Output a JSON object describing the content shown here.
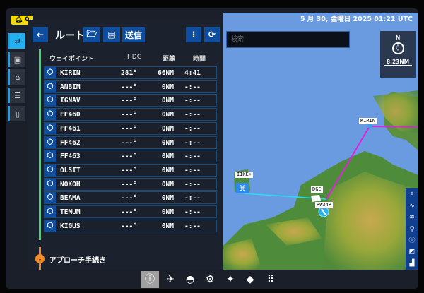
{
  "alerts": {
    "count": "0",
    "icon": "bell-icon"
  },
  "sidebar": {
    "items": [
      {
        "name": "route",
        "icon": "route-icon"
      },
      {
        "name": "checklist",
        "icon": "clipboard-icon"
      },
      {
        "name": "weight",
        "icon": "weight-icon"
      },
      {
        "name": "notes",
        "icon": "document-icon"
      },
      {
        "name": "clipboard",
        "icon": "clipboard-blank-icon"
      }
    ]
  },
  "toolbar": {
    "back": "←",
    "title": "ルート",
    "open": "🗁",
    "save": "💾",
    "send": "送信",
    "collapse": "⌄",
    "refresh": "⟳"
  },
  "table": {
    "headers": {
      "waypoint": "ウェイポイント",
      "hdg": "HDG",
      "dist": "距離",
      "time": "時間"
    },
    "rows": [
      {
        "name": "KIRIN",
        "hdg": "281°",
        "dist": "66NM",
        "time": "4:41"
      },
      {
        "name": "ANBIM",
        "hdg": "---°",
        "dist": "0NM",
        "time": "-:--"
      },
      {
        "name": "IGNAV",
        "hdg": "---°",
        "dist": "0NM",
        "time": "-:--"
      },
      {
        "name": "FF460",
        "hdg": "---°",
        "dist": "0NM",
        "time": "-:--"
      },
      {
        "name": "FF461",
        "hdg": "---°",
        "dist": "0NM",
        "time": "-:--"
      },
      {
        "name": "FF462",
        "hdg": "---°",
        "dist": "0NM",
        "time": "-:--"
      },
      {
        "name": "FF463",
        "hdg": "---°",
        "dist": "0NM",
        "time": "-:--"
      },
      {
        "name": "OLSIT",
        "hdg": "---°",
        "dist": "0NM",
        "time": "-:--"
      },
      {
        "name": "NOKOH",
        "hdg": "---°",
        "dist": "0NM",
        "time": "-:--"
      },
      {
        "name": "BEAMA",
        "hdg": "---°",
        "dist": "0NM",
        "time": "-:--"
      },
      {
        "name": "TEMUM",
        "hdg": "---°",
        "dist": "0NM",
        "time": "-:--"
      },
      {
        "name": "KIGUS",
        "hdg": "---°",
        "dist": "0NM",
        "time": "-:--"
      }
    ]
  },
  "approach": {
    "label": "アプローチ手続き"
  },
  "map": {
    "datetime": "5 月 30, 金曜日 2025 01:21 UTC",
    "search_placeholder": "検索",
    "compass": "N",
    "scale": "8.23NM",
    "labels": {
      "kirin": "KIRIN",
      "ike": "IIKE+",
      "dgc": "DGC",
      "rwy": "RW34R"
    },
    "colors": {
      "route": "#e020e0",
      "direct": "#20e0f0",
      "water": "#6a9be0"
    }
  },
  "bottom_nav": [
    {
      "name": "info",
      "glyph": "ⓘ"
    },
    {
      "name": "aircraft",
      "glyph": "✈"
    },
    {
      "name": "pilot",
      "glyph": "◓"
    },
    {
      "name": "settings",
      "glyph": "⚙"
    },
    {
      "name": "navigation",
      "glyph": "✦"
    },
    {
      "name": "charts",
      "glyph": "◆"
    },
    {
      "name": "apps",
      "glyph": "⠿"
    }
  ]
}
